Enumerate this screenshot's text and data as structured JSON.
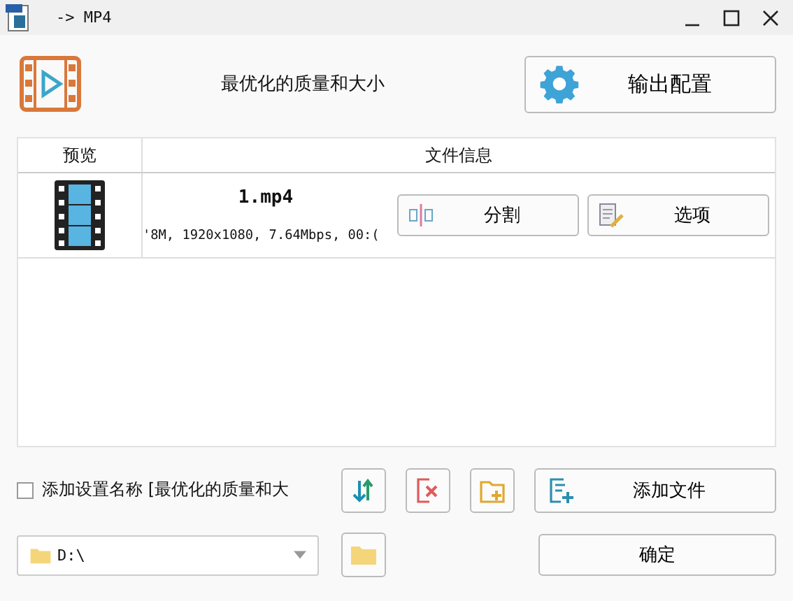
{
  "window": {
    "title": "-> MP4"
  },
  "profile": {
    "name": "最优化的质量和大小",
    "config_button": "输出配置"
  },
  "table": {
    "columns": [
      "预览",
      "文件信息"
    ],
    "rows": [
      {
        "file_name": "1.mp4",
        "details": "'8M, 1920x1080, 7.64Mbps, 00:(",
        "buttons": [
          {
            "kind": "split",
            "label": "分割"
          },
          {
            "kind": "options",
            "label": "选项"
          }
        ]
      }
    ]
  },
  "add_setting_name": {
    "label": "添加设置名称 [最优化的质量和大",
    "checked": false
  },
  "add_file_button": "添加文件",
  "output_folder": {
    "value": "D:\\"
  },
  "ok_button": "确定"
}
